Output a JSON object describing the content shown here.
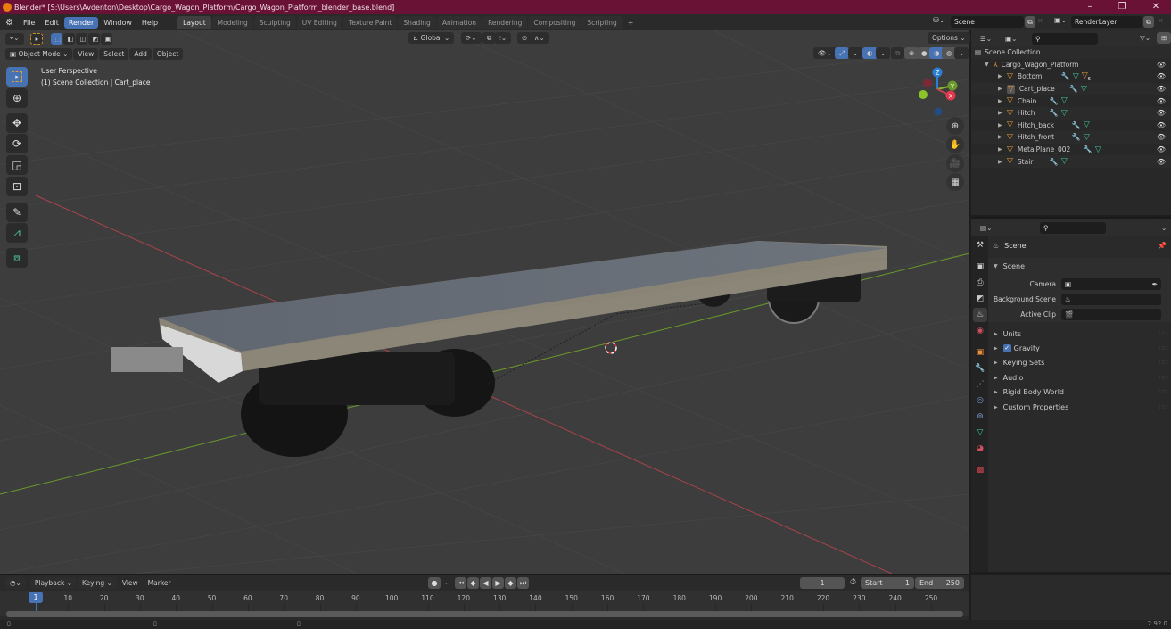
{
  "window": {
    "title": "Blender* [S:\\Users\\Avdenton\\Desktop\\Cargo_Wagon_Platform/Cargo_Wagon_Platform_blender_base.blend]",
    "minimize": "–",
    "maximize": "❐",
    "close": "✕"
  },
  "menubar": {
    "items": [
      "File",
      "Edit",
      "Render",
      "Window",
      "Help"
    ],
    "active_item": "Render",
    "workspaces": [
      "Layout",
      "Modeling",
      "Sculpting",
      "UV Editing",
      "Texture Paint",
      "Shading",
      "Animation",
      "Rendering",
      "Compositing",
      "Scripting"
    ],
    "active_workspace": "Layout",
    "add_workspace": "+",
    "scene_name": "Scene",
    "view_layer_name": "RenderLayer"
  },
  "viewport": {
    "header": {
      "transform_orientation": "Global",
      "options_label": "Options",
      "mode": "Object Mode",
      "menus": [
        "View",
        "Select",
        "Add",
        "Object"
      ]
    },
    "overlay_text": {
      "view_name": "User Perspective",
      "context": "(1) Scene Collection | Cart_place"
    },
    "gizmo": {
      "x": "X",
      "y": "Y",
      "z": "Z"
    },
    "tools": [
      "select-box",
      "cursor",
      "move",
      "rotate",
      "scale",
      "transform",
      "annotate",
      "measure",
      "add-cube"
    ],
    "active_tool": "select-box"
  },
  "outliner": {
    "root": "Scene Collection",
    "collection": "Cargo_Wagon_Platform",
    "objects": [
      {
        "name": "Bottom",
        "extra_badge": "6"
      },
      {
        "name": "Cart_place",
        "selected": true
      },
      {
        "name": "Chain"
      },
      {
        "name": "Hitch"
      },
      {
        "name": "Hitch_back"
      },
      {
        "name": "Hitch_front"
      },
      {
        "name": "MetalPlane_002"
      },
      {
        "name": "Stair"
      }
    ]
  },
  "properties": {
    "context_title": "Scene",
    "panel_title": "Scene",
    "fields": [
      {
        "label": "Camera",
        "value": ""
      },
      {
        "label": "Background Scene",
        "value": ""
      },
      {
        "label": "Active Clip",
        "value": ""
      }
    ],
    "collapsed_panels": [
      {
        "label": "Units",
        "checkbox": false
      },
      {
        "label": "Gravity",
        "checkbox": true,
        "checked": true
      },
      {
        "label": "Keying Sets",
        "checkbox": false
      },
      {
        "label": "Audio",
        "checkbox": false
      },
      {
        "label": "Rigid Body World",
        "checkbox": false
      },
      {
        "label": "Custom Properties",
        "checkbox": false
      }
    ]
  },
  "timeline": {
    "menus": [
      "Playback",
      "Keying",
      "View",
      "Marker"
    ],
    "current_frame": "1",
    "start_label": "Start",
    "start_value": "1",
    "end_label": "End",
    "end_value": "250",
    "ticks": [
      "10",
      "20",
      "30",
      "40",
      "50",
      "60",
      "70",
      "80",
      "90",
      "100",
      "110",
      "120",
      "130",
      "140",
      "150",
      "160",
      "170",
      "180",
      "190",
      "200",
      "210",
      "220",
      "230",
      "240",
      "250"
    ],
    "playhead_label": "1"
  },
  "statusbar": {
    "version": "2.92.0"
  },
  "colors": {
    "accent": "#4772b3",
    "titlebar": "#6a1236",
    "x_axis": "#c8404e",
    "y_axis": "#86b42c",
    "z_axis": "#2a7fd4",
    "object_orange": "#e89a3c",
    "mesh_green": "#3fc59b"
  }
}
